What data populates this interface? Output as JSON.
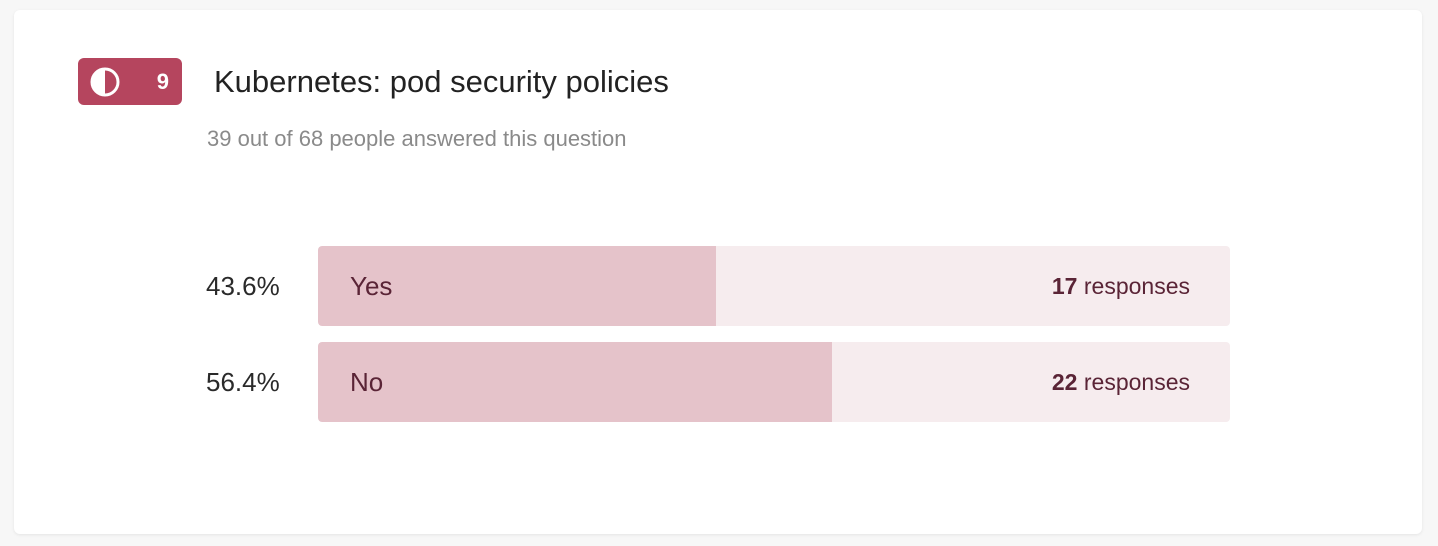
{
  "question": {
    "number": "9",
    "icon": "half-circle-icon",
    "accent_color": "#b5455e",
    "title": "Kubernetes: pod security policies",
    "answered_text": "39 out of 68 people answered this question"
  },
  "options": [
    {
      "percent_label": "43.6%",
      "label": "Yes",
      "count": "17",
      "count_suffix": "responses",
      "share": 0.436
    },
    {
      "percent_label": "56.4%",
      "label": "No",
      "count": "22",
      "count_suffix": "responses",
      "share": 0.564
    }
  ],
  "colors": {
    "bar_fill": "#e5c3ca",
    "bar_track": "#f6ecee",
    "label_text": "#5a2436"
  }
}
